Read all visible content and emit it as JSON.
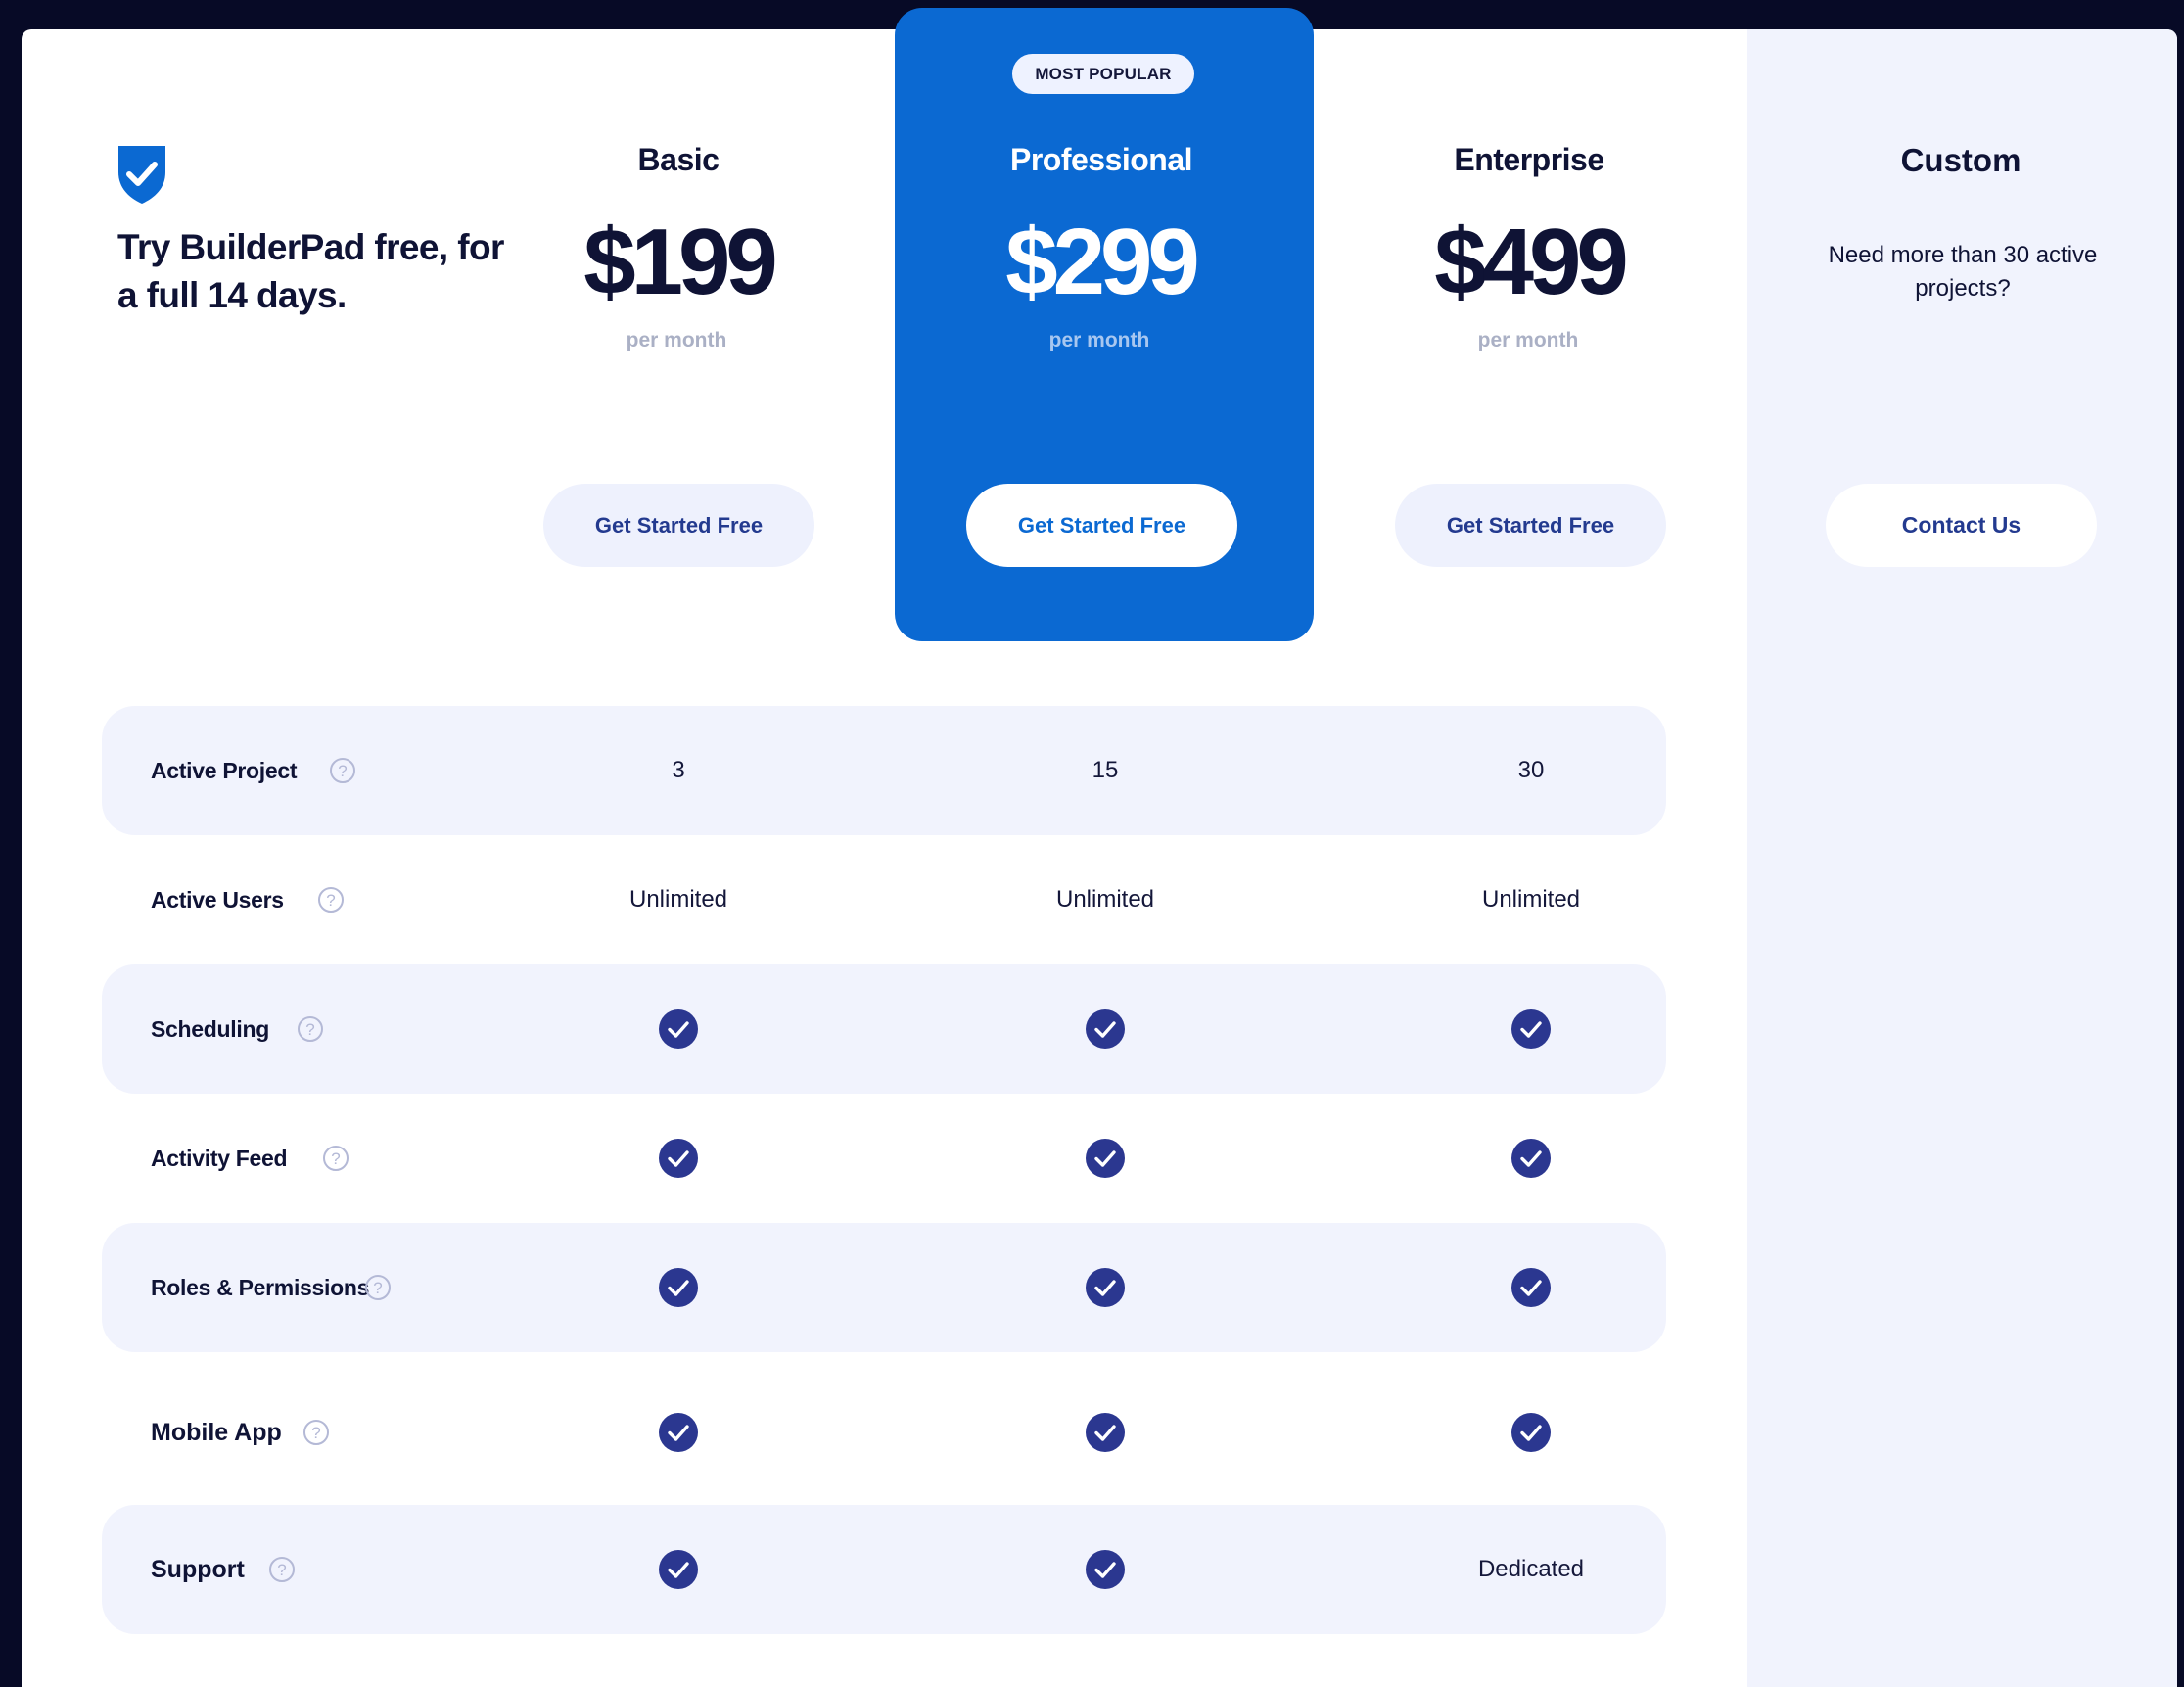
{
  "intro": {
    "tagline": "Try BuilderPad free, for a full 14 days.",
    "icon": "shield-check-icon"
  },
  "badge": "MOST POPULAR",
  "plans": [
    {
      "name": "Basic",
      "price": "$199",
      "period": "per month",
      "cta": "Get Started Free"
    },
    {
      "name": "Professional",
      "price": "$299",
      "period": "per month",
      "cta": "Get Started Free"
    },
    {
      "name": "Enterprise",
      "price": "$499",
      "period": "per month",
      "cta": "Get Started Free"
    }
  ],
  "custom": {
    "name": "Custom",
    "description": "Need more than 30 active projects?",
    "cta": "Contact Us"
  },
  "features": [
    {
      "label": "Active Project",
      "values": [
        "3",
        "15",
        "30"
      ]
    },
    {
      "label": "Active Users",
      "values": [
        "Unlimited",
        "Unlimited",
        "Unlimited"
      ]
    },
    {
      "label": "Scheduling",
      "values": [
        "check",
        "check",
        "check"
      ]
    },
    {
      "label": "Activity Feed",
      "values": [
        "check",
        "check",
        "check"
      ]
    },
    {
      "label": "Roles & Permissions",
      "values": [
        "check",
        "check",
        "check"
      ]
    },
    {
      "label": "Mobile App",
      "values": [
        "check",
        "check",
        "check"
      ]
    },
    {
      "label": "Support",
      "values": [
        "check",
        "check",
        "Dedicated"
      ]
    }
  ],
  "colors": {
    "background": "#070a26",
    "accent": "#0b69d2",
    "check": "#2b3790",
    "row_shade": "#f1f3fd",
    "muted": "#aab0c5"
  }
}
